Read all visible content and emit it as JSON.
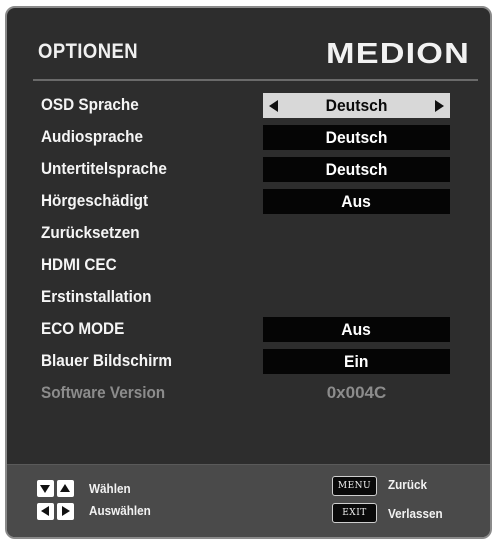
{
  "header": {
    "title": "OPTIONEN",
    "brand": "MEDION"
  },
  "menu": [
    {
      "label": "OSD Sprache",
      "value": "Deutsch",
      "has_arrows": true,
      "selected": true
    },
    {
      "label": "Audiosprache",
      "value": "Deutsch"
    },
    {
      "label": "Untertitelsprache",
      "value": "Deutsch"
    },
    {
      "label": "Hörgeschädigt",
      "value": "Aus"
    },
    {
      "label": "Zurücksetzen"
    },
    {
      "label": "HDMI CEC"
    },
    {
      "label": "Erstinstallation"
    },
    {
      "label": "ECO MODE",
      "value": "Aus"
    },
    {
      "label": "Blauer Bildschirm",
      "value": "Ein"
    },
    {
      "label": "Software Version",
      "value": "0x004C",
      "disabled": true
    }
  ],
  "footer": {
    "select_label": "Wählen",
    "choose_label": "Auswählen",
    "back_key": "MENU",
    "back_label": "Zurück",
    "exit_key": "EXIT",
    "exit_label": "Verlassen"
  },
  "colors": {
    "panel": "#2d2d2d",
    "footer": "#4a4a4a",
    "value_box": "#050505",
    "selected_box": "#d8d8d8",
    "disabled_text": "#8c8c8c"
  },
  "icons": [
    "left-arrow-icon",
    "right-arrow-icon",
    "down-arrow-key-icon",
    "up-arrow-key-icon",
    "left-arrow-key-icon",
    "right-arrow-key-icon",
    "medion-logo"
  ]
}
